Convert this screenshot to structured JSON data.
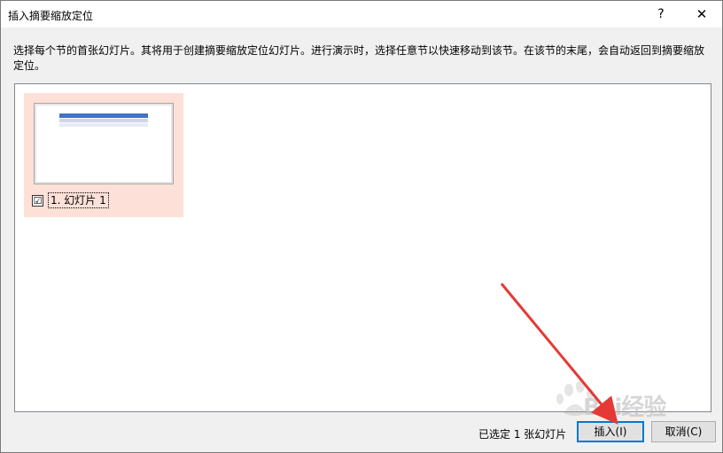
{
  "dialog": {
    "title": "插入摘要缩放定位",
    "help_label": "?",
    "close_label": "✕",
    "description": "选择每个节的首张幻灯片。其将用于创建摘要缩放定位幻灯片。进行演示时，选择任意节以快速移动到该节。在该节的末尾，会自动返回到摘要缩放定位。",
    "slides": [
      {
        "label": "1. 幻灯片 1",
        "checked": true,
        "check_glyph": "☑"
      }
    ],
    "status": "已选定 1 张幻灯片",
    "insert_label": "插入(I)",
    "cancel_label": "取消(C)"
  },
  "watermark": {
    "text": "Bai经验"
  },
  "colors": {
    "selection_bg": "#fde0d8",
    "thumb_title_bar": "#4472c4",
    "default_button_border": "#0078d7",
    "annotation_arrow": "#e53935"
  }
}
